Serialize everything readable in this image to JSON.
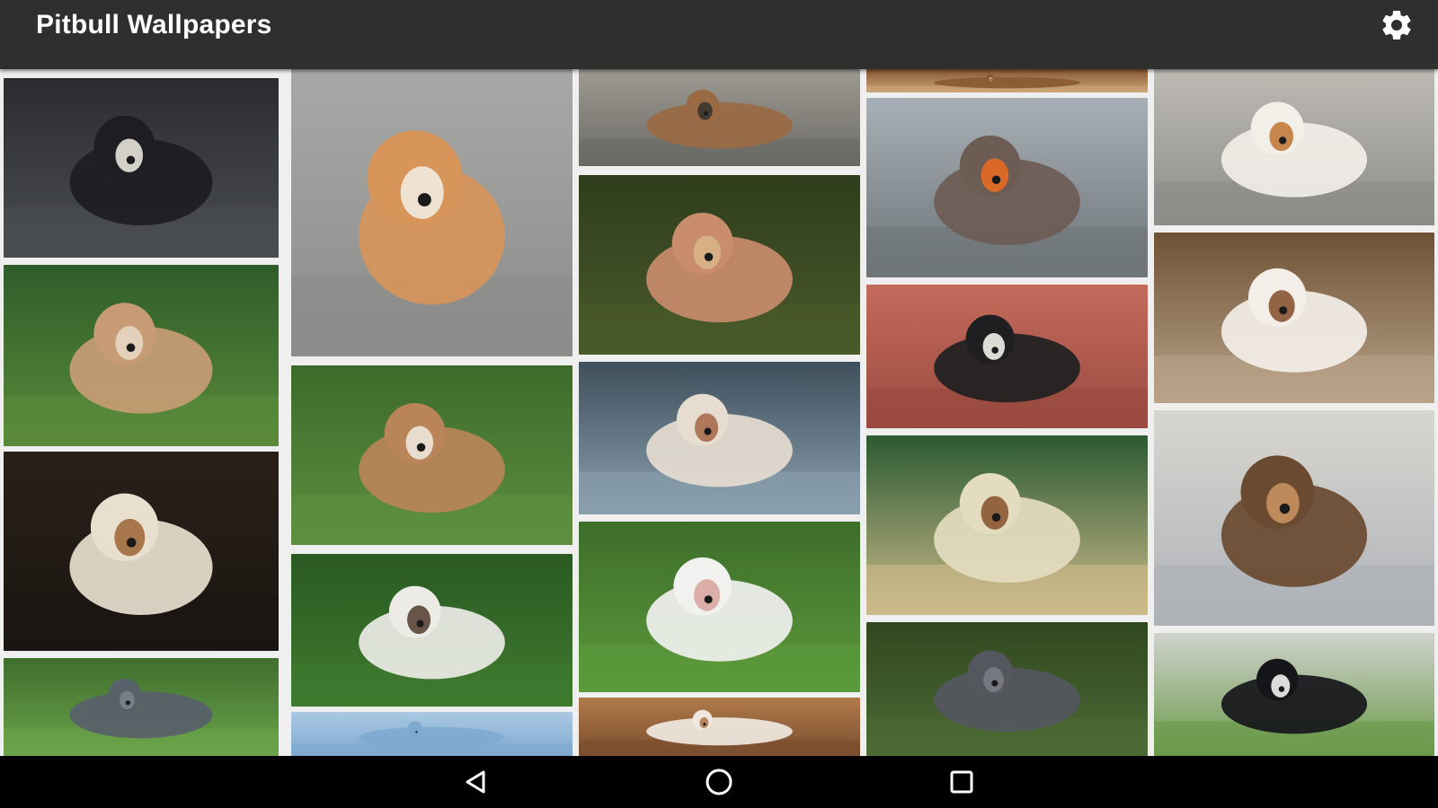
{
  "app": {
    "title": "Pitbull Wallpapers",
    "settings_icon": "gear-icon"
  },
  "colors": {
    "appbar_bg": "#2f2f2f",
    "grid_bg": "#efefef",
    "navbar_bg": "#000000",
    "icon": "#ffffff"
  },
  "nav": {
    "back_icon": "back-triangle-icon",
    "home_icon": "home-circle-icon",
    "recents_icon": "recents-square-icon"
  },
  "gallery": [
    {
      "name": "pitbull-behind-fence",
      "bg": "#4b4f50",
      "accent": "#2b2c30",
      "dog": "#1d1d22",
      "patch": "#e8e4dc"
    },
    {
      "name": "pitbull-blue-collar-grass",
      "bg": "#5a8a3a",
      "accent": "#2f5d2a",
      "dog": "#c79c74",
      "patch": "#e7d7c3"
    },
    {
      "name": "pitbull-portrait-dark",
      "bg": "#1a1612",
      "accent": "#2a2018",
      "dog": "#e9dfcf",
      "patch": "#a06a3c"
    },
    {
      "name": "pitbull-blue-on-grass",
      "bg": "#6aa34a",
      "accent": "#3f6f2e",
      "dog": "#58606a",
      "patch": "#7a828c"
    },
    {
      "name": "puppy-on-steps",
      "bg": "#8c8c8a",
      "accent": "#a8a8a6",
      "dog": "#d8955a",
      "patch": "#f1ebe0"
    },
    {
      "name": "two-dogs-playing",
      "bg": "#5e8f3f",
      "accent": "#3c6b2b",
      "dog": "#b88458",
      "patch": "#ece6dc"
    },
    {
      "name": "pitbull-face-green",
      "bg": "#3f7a2f",
      "accent": "#2a5a22",
      "dog": "#ecebe6",
      "patch": "#5a4436"
    },
    {
      "name": "sky-strip",
      "bg": "#7fa9cf",
      "accent": "#a9c8e3",
      "dog": "#7fa9cf",
      "patch": "#7fa9cf"
    },
    {
      "name": "dog-on-rocks",
      "bg": "#6b6b66",
      "accent": "#9e9a92",
      "dog": "#9a6a44",
      "patch": "#3a3530"
    },
    {
      "name": "dog-in-field",
      "bg": "#4a5a2a",
      "accent": "#2f3d1c",
      "dog": "#c98c6c",
      "patch": "#d9b48a"
    },
    {
      "name": "dog-at-beach",
      "bg": "#8aa0ae",
      "accent": "#3f4f5c",
      "dog": "#e6dcd0",
      "patch": "#a86c4c"
    },
    {
      "name": "smiling-white-pitbull",
      "bg": "#5c9a3c",
      "accent": "#3d6d2a",
      "dog": "#f1f1ef",
      "patch": "#d8a6a0"
    },
    {
      "name": "dog-autumn-leaves",
      "bg": "#7a4e2e",
      "accent": "#b07a4a",
      "dog": "#f0e8e0",
      "patch": "#b07a4a"
    },
    {
      "name": "dog-strip-top",
      "bg": "#c9a47a",
      "accent": "#8a5a32",
      "dog": "#8a5a32",
      "patch": "#c9a47a"
    },
    {
      "name": "pitbull-orange-bandana",
      "bg": "#6e7478",
      "accent": "#a7b0b6",
      "dog": "#6d5c54",
      "patch": "#e66a22"
    },
    {
      "name": "pitbull-brick-wall",
      "bg": "#9a4a40",
      "accent": "#c46b5c",
      "dog": "#1f1f22",
      "patch": "#f1efea"
    },
    {
      "name": "puppy-under-chair",
      "bg": "#cdbb8a",
      "accent": "#2b5a32",
      "dog": "#e4dcc0",
      "patch": "#8a5630"
    },
    {
      "name": "blue-pitbull-grass",
      "bg": "#4c6a34",
      "accent": "#30481f",
      "dog": "#54575d",
      "patch": "#797c82"
    },
    {
      "name": "dog-legs-closeup",
      "bg": "#8c8c88",
      "accent": "#bdbab4",
      "dog": "#f2eee8",
      "patch": "#c27a3a"
    },
    {
      "name": "puppy-lying-deck",
      "bg": "#b9a489",
      "accent": "#6f5236",
      "dog": "#f3efe8",
      "patch": "#8a5232"
    },
    {
      "name": "pack-of-dogs",
      "bg": "#aeb2b8",
      "accent": "#d8d6d0",
      "dog": "#6a4a30",
      "patch": "#c89060"
    },
    {
      "name": "black-white-pitbull",
      "bg": "#6a9a4a",
      "accent": "#cfd2cc",
      "dog": "#16161a",
      "patch": "#f1f1ef"
    }
  ]
}
